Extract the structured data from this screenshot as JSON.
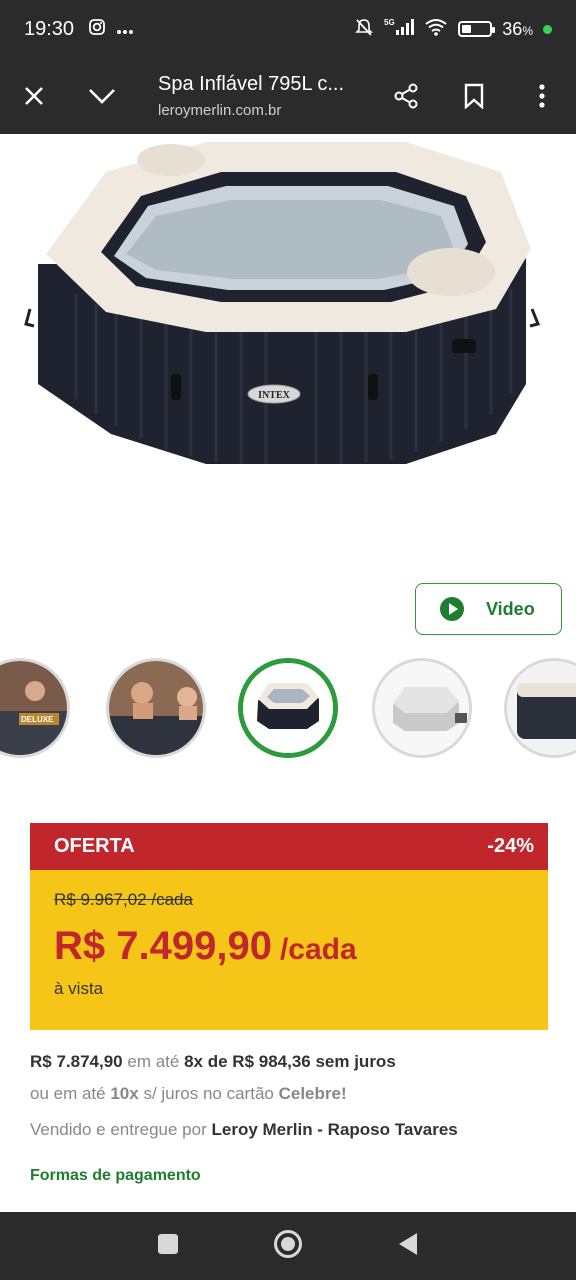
{
  "status": {
    "time": "19:30",
    "left_icons": [
      "instagram-icon",
      "more-dots-icon"
    ],
    "right_icons": [
      "muted-bell-icon",
      "5g-signal-icon",
      "wifi-icon",
      "battery-icon"
    ],
    "network": "5G",
    "battery_percent": "36",
    "battery_suffix": "%",
    "battery_level": 0.36
  },
  "toolbar": {
    "close_icon": "close-icon",
    "collapse_icon": "chevron-down-icon",
    "title": "Spa Inflável 795L c...",
    "url": "leroymerlin.com.br",
    "share_icon": "share-icon",
    "bookmark_icon": "bookmark-icon",
    "menu_icon": "more-vertical-icon"
  },
  "hero": {
    "brand_label": "INTEX"
  },
  "video_button": {
    "label": "Video",
    "icon": "play-icon"
  },
  "thumbnails": {
    "count": 5,
    "active_index": 2,
    "first_thumb_text": "DELUXE"
  },
  "offer": {
    "label": "OFERTA",
    "discount": "-24%",
    "old_price": "R$ 9.967,02 /cada",
    "price": "R$ 7.499,90",
    "price_unit": "/cada",
    "payment_note": "à vista"
  },
  "installments": {
    "total": "R$ 7.874,90",
    "connector": "em até",
    "text": "8x de R$ 984,36 sem juros"
  },
  "card_offer": {
    "prefix": "ou em até",
    "count": "10x",
    "middle": "s/ juros no cartão",
    "card_name": "Celebre!"
  },
  "seller": {
    "prefix": "Vendido e entregue por",
    "name": "Leroy Merlin - Raposo Tavares"
  },
  "payment_link": "Formas de pagamento",
  "nav": {
    "recents_icon": "square-icon",
    "home_icon": "circle-home-icon",
    "back_icon": "back-triangle-icon"
  },
  "colors": {
    "offer_red": "#c0262b",
    "offer_yellow": "#f5c518",
    "brand_green": "#2b9b3b"
  }
}
